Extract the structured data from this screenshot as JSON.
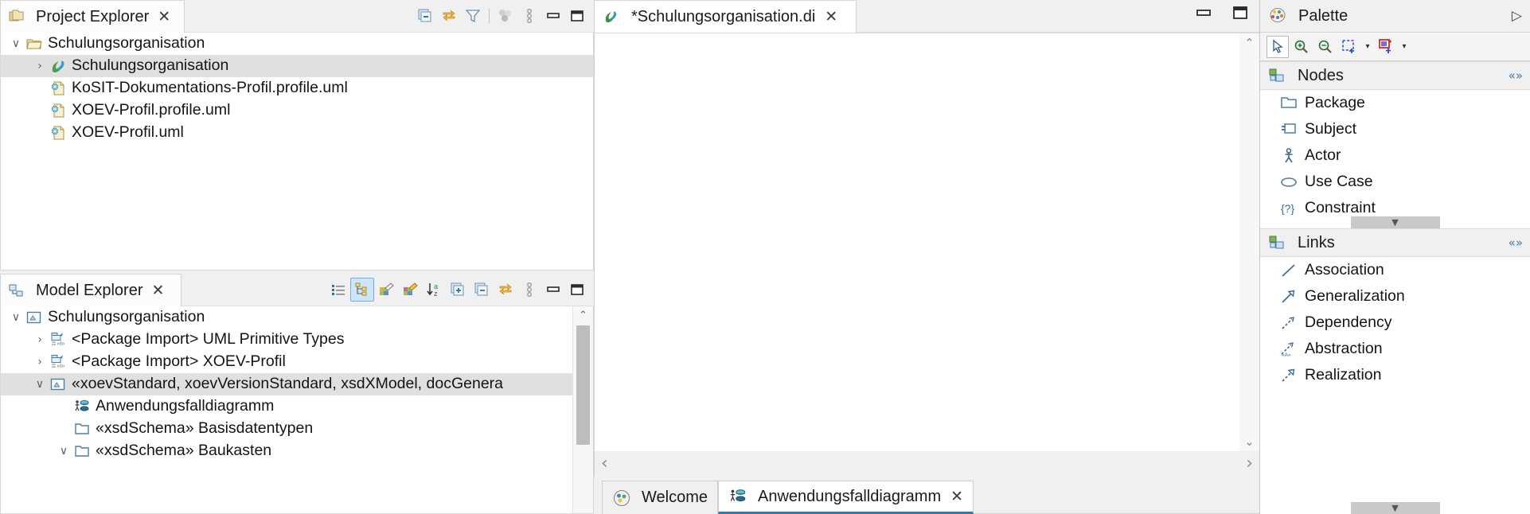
{
  "project_explorer": {
    "tab_label": "Project Explorer",
    "close_label": "✕",
    "toolbar": [
      {
        "name": "collapse-all-icon",
        "title": "Collapse All"
      },
      {
        "name": "link-with-editor-icon",
        "title": "Link with Editor"
      },
      {
        "name": "filter-icon",
        "title": "Filters"
      },
      {
        "name": "separator",
        "title": ""
      },
      {
        "name": "customize-view-icon",
        "title": "Customize View"
      },
      {
        "name": "view-menu-icon",
        "title": "View Menu"
      },
      {
        "name": "minimize-icon",
        "title": "Minimize"
      },
      {
        "name": "maximize-icon",
        "title": "Maximize"
      }
    ],
    "tree": [
      {
        "label": "Schulungsorganisation",
        "indent": 0,
        "twist": "∨",
        "icon": "project-folder-icon",
        "selected": false
      },
      {
        "label": "Schulungsorganisation",
        "indent": 1,
        "twist": "›",
        "icon": "uml-model-icon",
        "selected": true
      },
      {
        "label": "KoSIT-Dokumentations-Profil.profile.uml",
        "indent": 1,
        "twist": "",
        "icon": "uml-file-icon",
        "selected": false
      },
      {
        "label": "XOEV-Profil.profile.uml",
        "indent": 1,
        "twist": "",
        "icon": "uml-file-icon",
        "selected": false
      },
      {
        "label": "XOEV-Profil.uml",
        "indent": 1,
        "twist": "",
        "icon": "uml-file-icon",
        "selected": false
      }
    ]
  },
  "model_explorer": {
    "tab_label": "Model Explorer",
    "close_label": "✕",
    "toolbar": [
      {
        "name": "show-list-icon",
        "title": "Flat List"
      },
      {
        "name": "show-tree-icon",
        "title": "Tree View"
      },
      {
        "name": "edit-filter-icon",
        "title": "Edit Filter"
      },
      {
        "name": "new-filter-icon",
        "title": "New Filter"
      },
      {
        "name": "sort-az-icon",
        "title": "Sort A-Z"
      },
      {
        "name": "expand-all-icon",
        "title": "Expand All"
      },
      {
        "name": "collapse-all-icon",
        "title": "Collapse All"
      },
      {
        "name": "link-with-editor-icon",
        "title": "Link with Editor"
      },
      {
        "name": "view-menu-icon",
        "title": "View Menu"
      },
      {
        "name": "minimize-icon",
        "title": "Minimize"
      },
      {
        "name": "maximize-icon",
        "title": "Maximize"
      }
    ],
    "tree": [
      {
        "label": "Schulungsorganisation",
        "indent": 0,
        "twist": "∨",
        "icon": "model-icon",
        "selected": false
      },
      {
        "label": "<Package Import> UML Primitive Types",
        "indent": 1,
        "twist": "›",
        "icon": "package-import-icon",
        "selected": false
      },
      {
        "label": "<Package Import> XOEV-Profil",
        "indent": 1,
        "twist": "›",
        "icon": "package-import-icon",
        "selected": false
      },
      {
        "label": "«xoevStandard, xoevVersionStandard, xsdXModel, docGenera",
        "indent": 1,
        "twist": "∨",
        "icon": "model-icon",
        "selected": true
      },
      {
        "label": "Anwendungsfalldiagramm",
        "indent": 2,
        "twist": "",
        "icon": "usecase-diagram-icon",
        "selected": false
      },
      {
        "label": "«xsdSchema» Basisdatentypen",
        "indent": 2,
        "twist": "",
        "icon": "package-icon",
        "selected": false
      },
      {
        "label": "«xsdSchema» Baukasten",
        "indent": 2,
        "twist": "∨",
        "icon": "package-icon",
        "selected": false
      }
    ]
  },
  "editor": {
    "tab_label": "*Schulungsorganisation.di",
    "close_label": "✕",
    "window_controls": [
      {
        "name": "minimize-icon",
        "title": "Minimize"
      },
      {
        "name": "maximize-icon",
        "title": "Maximize"
      }
    ],
    "hscroll": {
      "left_arrow": "‹",
      "right_arrow": "›"
    },
    "vscroll": {
      "up_arrow": "⌃",
      "down_arrow": "⌄"
    },
    "bottom_tabs": [
      {
        "label": "Welcome",
        "icon": "welcome-icon",
        "active": false,
        "closable": false
      },
      {
        "label": "Anwendungsfalldiagramm",
        "icon": "usecase-diagram-icon",
        "active": true,
        "closable": true,
        "close_label": "✕"
      }
    ]
  },
  "palette": {
    "title": "Palette",
    "pin_label": "▷",
    "tools": [
      {
        "name": "select-tool-icon",
        "title": "Select",
        "selected": true,
        "caret": false
      },
      {
        "name": "zoom-in-icon",
        "title": "Zoom In",
        "selected": false,
        "caret": false
      },
      {
        "name": "zoom-out-icon",
        "title": "Zoom Out",
        "selected": false,
        "caret": false
      },
      {
        "name": "marquee-tool-icon",
        "title": "Marquee",
        "selected": false,
        "caret": true
      },
      {
        "name": "note-attachment-icon",
        "title": "Note",
        "selected": false,
        "caret": true
      }
    ],
    "groups": [
      {
        "title": "Nodes",
        "collapse_label": "«»",
        "items": [
          {
            "label": "Package",
            "icon": "package-icon"
          },
          {
            "label": "Subject",
            "icon": "subject-icon"
          },
          {
            "label": "Actor",
            "icon": "actor-icon"
          },
          {
            "label": "Use Case",
            "icon": "usecase-icon"
          },
          {
            "label": "Constraint",
            "icon": "constraint-icon"
          }
        ],
        "scroll_down": "▼"
      },
      {
        "title": "Links",
        "collapse_label": "«»",
        "items": [
          {
            "label": "Association",
            "icon": "association-icon"
          },
          {
            "label": "Generalization",
            "icon": "generalization-icon"
          },
          {
            "label": "Dependency",
            "icon": "dependency-icon"
          },
          {
            "label": "Abstraction",
            "icon": "abstraction-icon"
          },
          {
            "label": "Realization",
            "icon": "realization-icon"
          }
        ],
        "scroll_down": "▼"
      }
    ]
  },
  "colors": {
    "selection": "#e0e0e0",
    "tab_active_underline": "#2a7ab5",
    "panel_bg": "#f0f0f0",
    "icon_blue": "#3f7ca8",
    "icon_yellow": "#e8a33d"
  }
}
